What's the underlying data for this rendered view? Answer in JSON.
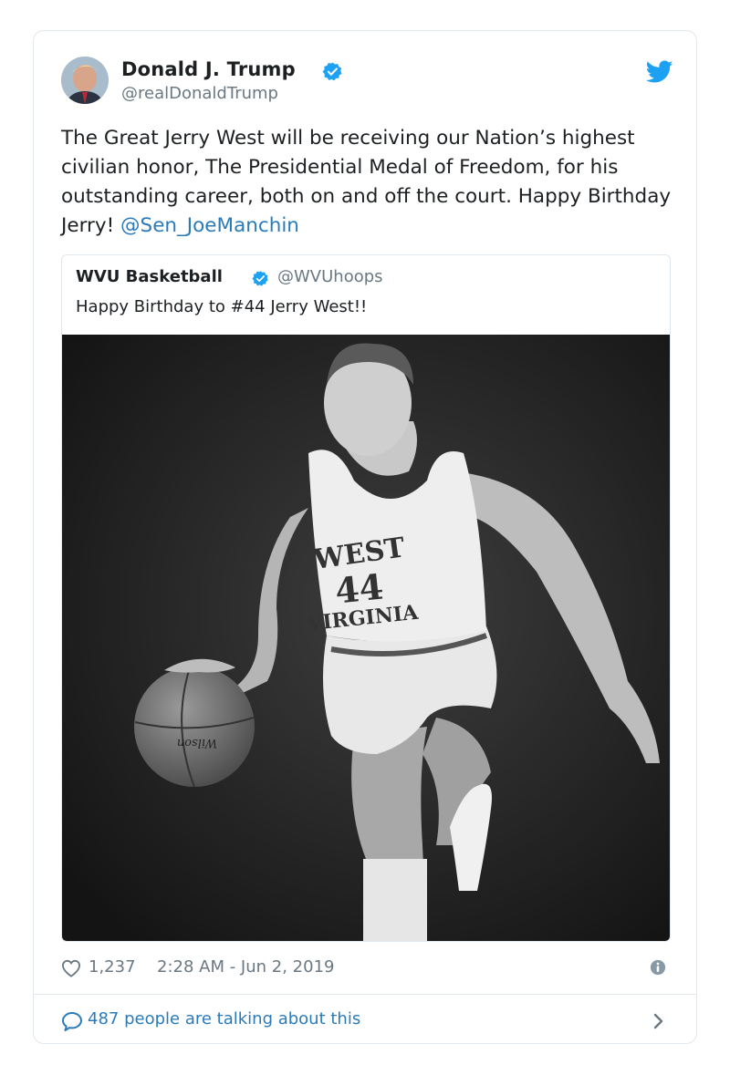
{
  "tweet": {
    "author": {
      "name": "Donald J. Trump",
      "handle": "@realDonaldTrump",
      "verified": true
    },
    "text_main": "The Great Jerry West will be receiving our Nation’s highest civilian honor, The Presidential Medal of Freedom, for his outstanding career, both on and off the court. Happy Birthday Jerry! ",
    "mention": "@Sen_JoeManchin",
    "quoted": {
      "name": "WVU Basketball",
      "handle": "@WVUhoops",
      "verified": true,
      "text": "Happy Birthday to #44 Jerry West!!",
      "image": {
        "jersey_line1": "WEST",
        "jersey_number": "44",
        "jersey_line2": "VIRGINIA",
        "ball_brand": "Wilson"
      }
    },
    "likes": "1,237",
    "timestamp": "2:28 AM - Jun 2, 2019",
    "talking": "487 people are talking about this"
  },
  "colors": {
    "link": "#2b7bb9",
    "twitter_blue": "#1da1f2",
    "muted": "#697882",
    "border": "#e1e8ed",
    "text": "#1c2022"
  },
  "icons": [
    "twitter-bird-icon",
    "verified-badge-icon",
    "heart-icon",
    "info-icon",
    "speech-bubble-icon",
    "chevron-right-icon"
  ]
}
